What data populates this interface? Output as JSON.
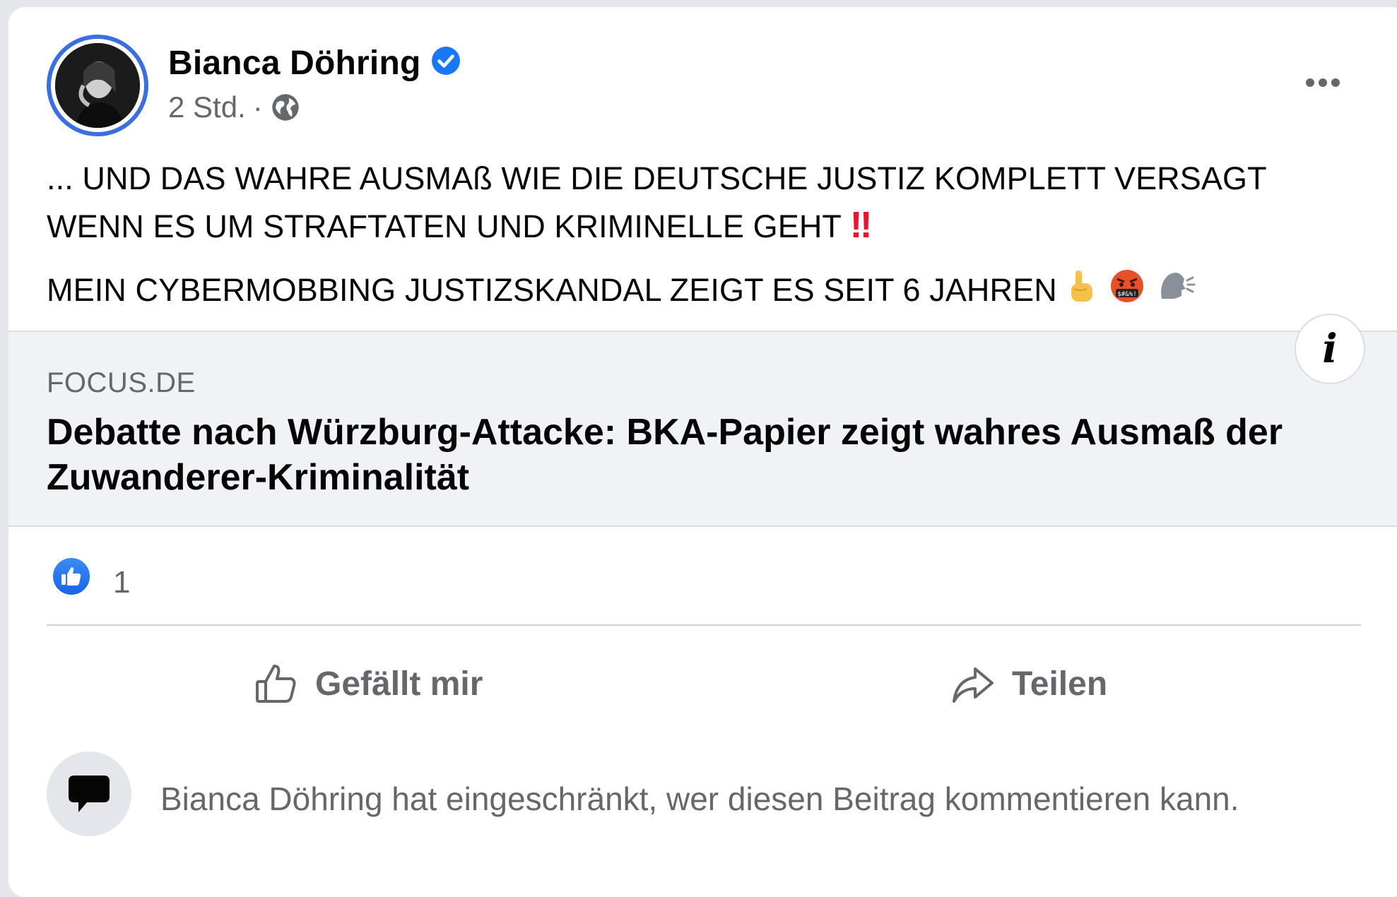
{
  "post": {
    "author": "Bianca Döhring",
    "time": "2 Std.",
    "separator": "·",
    "text_line1": "... UND DAS WAHRE AUSMAß WIE DIE DEUTSCHE JUSTIZ KOMPLETT VERSAGT WENN ES UM STRAFTATEN UND KRIMINELLE GEHT",
    "text_line1_emoji": "‼",
    "text_line2": "MEIN CYBERMOBBING JUSTIZSKANDAL ZEIGT ES SEIT 6 JAHREN",
    "text_line2_emojis": [
      "☝",
      "🤬",
      "🗣"
    ]
  },
  "link_preview": {
    "domain": "FOCUS.DE",
    "headline": "Debatte nach Würzburg-Attacke: BKA-Papier zeigt wahres Ausmaß der Zuwanderer-Kriminalität",
    "info_icon": "i"
  },
  "reactions": {
    "like_count": "1"
  },
  "actions": {
    "like_label": "Gefällt mir",
    "share_label": "Teilen"
  },
  "comments": {
    "restriction_note": "Bianca Döhring hat eingeschränkt, wer diesen Beitrag kommentieren kann."
  },
  "colors": {
    "accent_blue": "#1877f2",
    "secondary_text": "#65676b",
    "preview_bg": "#f0f2f5",
    "alert_red": "#e4182b"
  },
  "icons": [
    "verified-badge-icon",
    "globe-icon",
    "more-options-icon",
    "info-icon",
    "like-reaction-icon",
    "thumbs-up-icon",
    "share-arrow-icon",
    "comment-bubble-icon"
  ]
}
